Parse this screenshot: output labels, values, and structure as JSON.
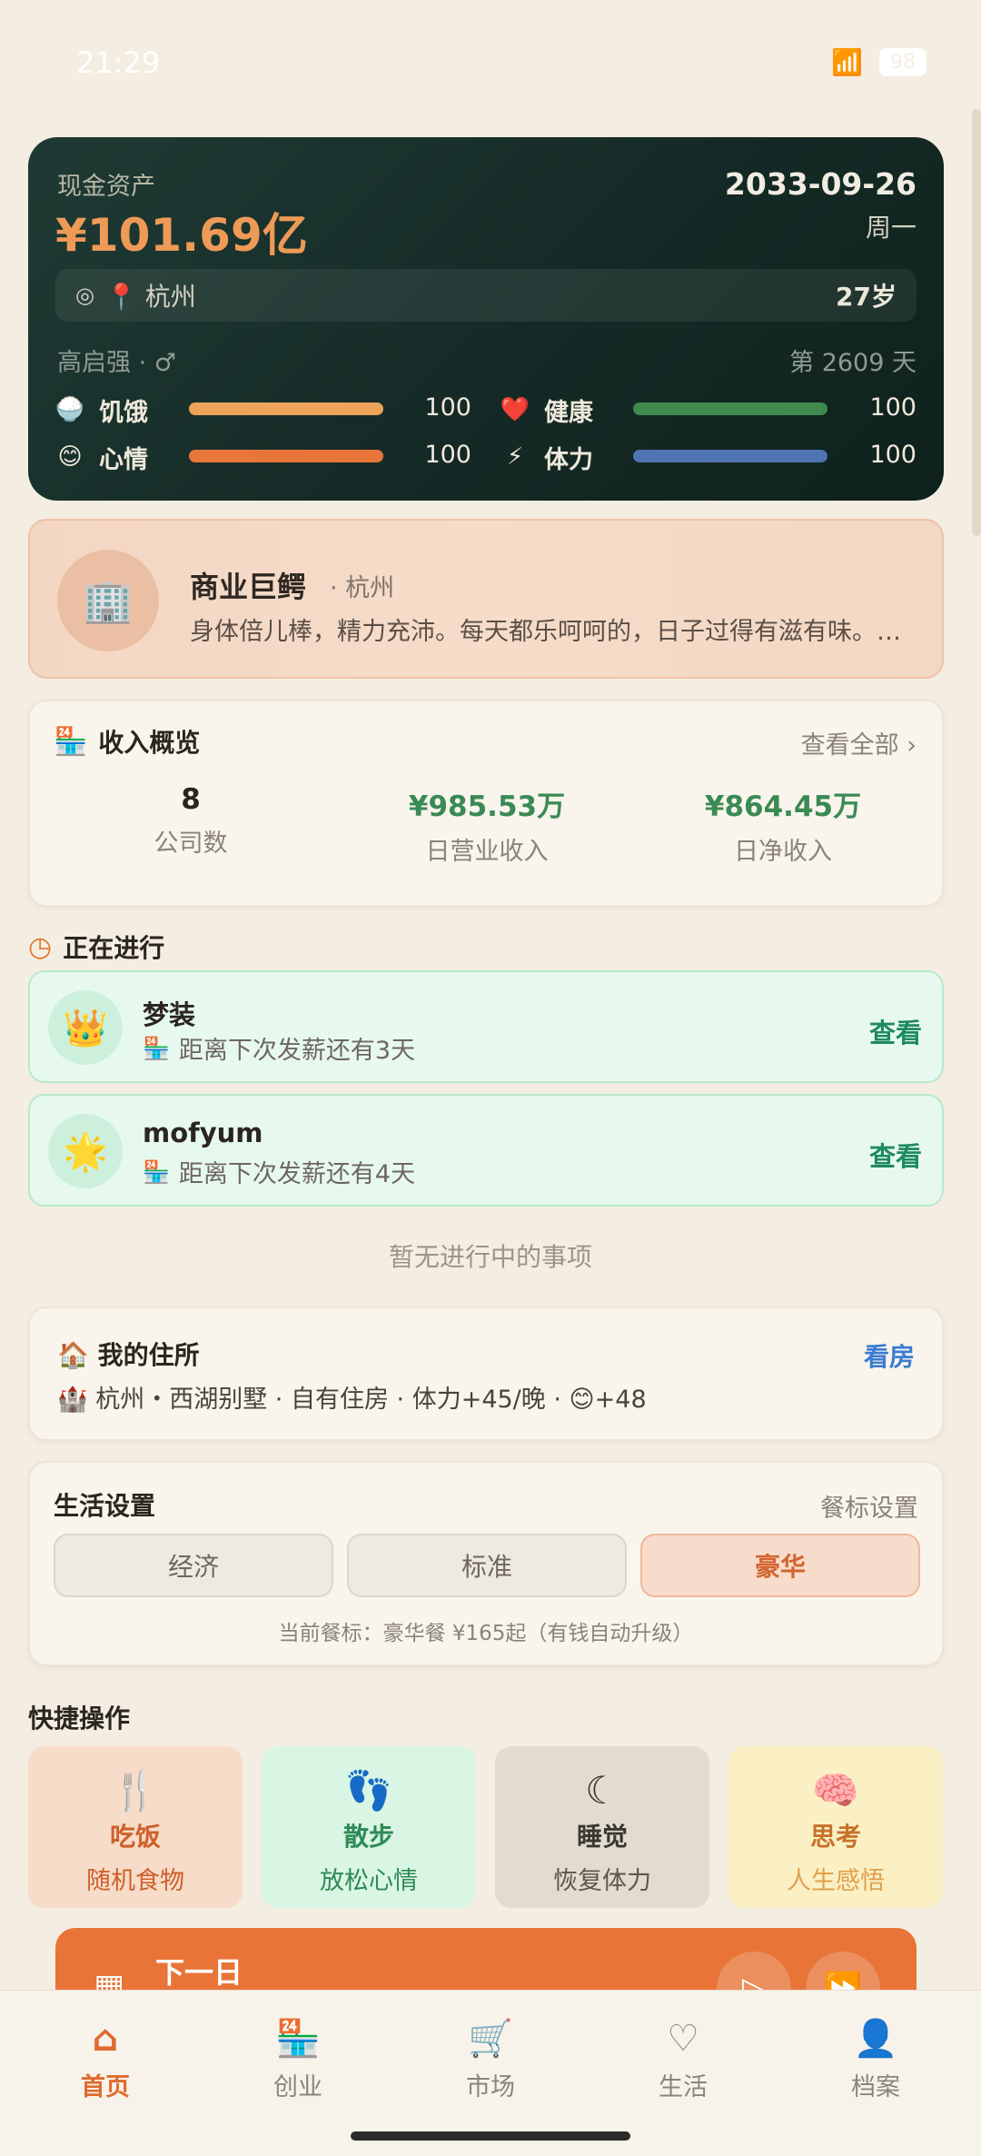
{
  "status": {
    "time": "21:29",
    "battery": "98"
  },
  "hero": {
    "cash_label": "现金资产",
    "cash": "¥101.69亿",
    "date": "2033-09-26",
    "weekday": "周一",
    "location": "📍 杭州",
    "age": "27岁",
    "name": "高启强 · ♂",
    "day_count": "第 2609 天",
    "stats": [
      {
        "icon": "🍚",
        "label": "饥饿",
        "value": "100",
        "fill": 1.0,
        "color": "#eda45a"
      },
      {
        "icon": "❤️",
        "label": "健康",
        "value": "100",
        "fill": 1.0,
        "color": "#3f8a4f"
      },
      {
        "icon": "😊",
        "label": "心情",
        "value": "100",
        "fill": 1.0,
        "color": "#e8763a"
      },
      {
        "icon": "⚡",
        "label": "体力",
        "value": "100",
        "fill": 1.0,
        "color": "#4f74b3"
      }
    ]
  },
  "title_card": {
    "avatar_icon": "🏢",
    "title": "商业巨鳄",
    "city": "· 杭州",
    "desc": "身体倍儿棒，精力充沛。每天都乐呵呵的，日子过得有滋有味。…"
  },
  "income": {
    "title": "收入概览",
    "view_all": "查看全部 ›",
    "items": [
      {
        "value": "8",
        "label": "公司数",
        "color": "#2b2520"
      },
      {
        "value": "¥985.53万",
        "label": "日营业收入",
        "color": "#3a8a55"
      },
      {
        "value": "¥864.45万",
        "label": "日净收入",
        "color": "#3a8a55"
      }
    ]
  },
  "ongoing": {
    "title": "正在进行",
    "jobs": [
      {
        "icon": "👑",
        "name": "梦装",
        "desc": "距离下次发薪还有3天",
        "action": "查看"
      },
      {
        "icon": "🌟",
        "name": "mofyum",
        "desc": "距离下次发薪还有4天",
        "action": "查看"
      }
    ],
    "empty": "暂无进行中的事项"
  },
  "home": {
    "title": "🏠 我的住所",
    "action": "看房",
    "desc": "🏰 杭州・西湖别墅 · 自有住房 · 体力+45/晚 · 😊+48"
  },
  "life": {
    "title": "生活设置",
    "settings": "餐标设置",
    "options": [
      "经济",
      "标准",
      "豪华"
    ],
    "active": 2,
    "note": "当前餐标：豪华餐 ¥165起（有钱自动升级）"
  },
  "quick": {
    "title": "快捷操作",
    "items": [
      {
        "icon": "🍴",
        "title": "吃饭",
        "sub": "随机食物",
        "bg": "#f6dcc9",
        "fg": "#cf5f2a"
      },
      {
        "icon": "👣",
        "title": "散步",
        "sub": "放松心情",
        "bg": "#d9f5e3",
        "fg": "#2f8a55"
      },
      {
        "icon": "☾",
        "title": "睡觉",
        "sub": "恢复体力",
        "bg": "#e2dccf",
        "fg": "#3b3631"
      },
      {
        "icon": "🧠",
        "title": "思考",
        "sub": "人生感悟",
        "bg": "#fbf0c4",
        "fg": "#c7722a"
      }
    ]
  },
  "next_day": {
    "label": "下一日"
  },
  "tabs": [
    {
      "icon": "⌂",
      "label": "首页",
      "active": true
    },
    {
      "icon": "🏪",
      "label": "创业",
      "active": false
    },
    {
      "icon": "🛒",
      "label": "市场",
      "active": false
    },
    {
      "icon": "♡",
      "label": "生活",
      "active": false
    },
    {
      "icon": "👤",
      "label": "档案",
      "active": false
    }
  ]
}
